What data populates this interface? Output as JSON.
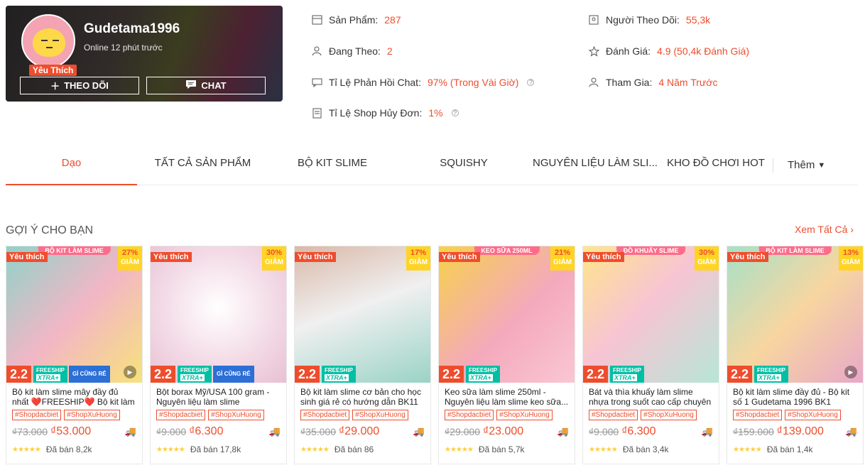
{
  "shop": {
    "name": "Gudetama1996",
    "status": "Online 12 phút trước",
    "badge": "Yêu Thích",
    "follow_label": "THEO DÕI",
    "chat_label": "CHAT"
  },
  "stats": {
    "products_label": "Sản Phẩm:",
    "products_value": "287",
    "following_label": "Đang Theo:",
    "following_value": "2",
    "chat_label": "Tỉ Lệ Phản Hồi Chat:",
    "chat_value": "97% (Trong Vài Giờ)",
    "cancel_label": "Tỉ Lệ Shop Hủy Đơn:",
    "cancel_value": "1%",
    "followers_label": "Người Theo Dõi:",
    "followers_value": "55,3k",
    "rating_label": "Đánh Giá:",
    "rating_value": "4.9 (50,4k Đánh Giá)",
    "joined_label": "Tham Gia:",
    "joined_value": "4 Năm Trước"
  },
  "tabs": [
    "Dạo",
    "TẤT CẢ SẢN PHẨM",
    "BỘ KIT SLIME",
    "SQUISHY",
    "NGUYÊN LIỆU LÀM SLI...",
    "KHO ĐỒ CHƠI HOT"
  ],
  "tab_more": "Thêm",
  "section": {
    "title": "GỢI Ý CHO BẠN",
    "see_all": "Xem Tất Cả"
  },
  "promo": {
    "day": "2.2",
    "freeship_top": "FREESHIP",
    "freeship_bottom": "XTRA+",
    "cheap": "GÌ CŨNG RẺ",
    "discount_word": "GIẢM",
    "fav": "Yêu thích"
  },
  "products": [
    {
      "name": "Bộ kit làm slime mây đầy đủ nhất ❤️FREESHIP❤️ Bộ kit làm clou...",
      "banner": "BỘ KIT LÀM SLIME",
      "discount": "27%",
      "old": "₫73.000",
      "new": "₫53.000",
      "sold": "Đã bán 8,2k",
      "tags": [
        "#Shopdacbiet",
        "#ShopXuHuong"
      ],
      "fav": true,
      "cheap": true,
      "video": true
    },
    {
      "name": "Bột borax Mỹ/USA 100 gram - Nguyên liệu làm slime",
      "banner": "",
      "discount": "30%",
      "old": "₫9.000",
      "new": "₫6.300",
      "sold": "Đã bán 17,8k",
      "tags": [
        "#Shopdacbiet",
        "#ShopXuHuong"
      ],
      "fav": true,
      "cheap": true,
      "video": false
    },
    {
      "name": "Bộ kit làm slime cơ bản cho học sinh giá rẻ có hướng dẫn BK11",
      "banner": "",
      "discount": "17%",
      "old": "₫35.000",
      "new": "₫29.000",
      "sold": "Đã bán 86",
      "tags": [
        "#Shopdacbiet",
        "#ShopXuHuong"
      ],
      "fav": true,
      "cheap": false,
      "video": false
    },
    {
      "name": "Keo sữa làm slime 250ml - Nguyên liệu làm slime keo sữa...",
      "banner": "KEO SỮA 250ML",
      "discount": "21%",
      "old": "₫29.000",
      "new": "₫23.000",
      "sold": "Đã bán 5,7k",
      "tags": [
        "#Shopdacbiet",
        "#ShopXuHuong"
      ],
      "fav": true,
      "cheap": false,
      "video": false
    },
    {
      "name": "Bát và thìa khuấy làm slime nhựa trong suốt cao cấp chuyên dụn...",
      "banner": "ĐỒ KHUẤY SLIME",
      "discount": "30%",
      "old": "₫9.000",
      "new": "₫6.300",
      "sold": "Đã bán 3,4k",
      "tags": [
        "#Shopdacbiet",
        "#ShopXuHuong"
      ],
      "fav": true,
      "cheap": false,
      "video": false
    },
    {
      "name": "Bộ kit làm slime đầy đủ - Bộ kit số 1 Gudetama 1996 BK1",
      "banner": "BỘ KIT LÀM SLIME",
      "discount": "13%",
      "old": "₫159.000",
      "new": "₫139.000",
      "sold": "Đã bán 1,4k",
      "tags": [
        "#Shopdacbiet",
        "#ShopXuHuong"
      ],
      "fav": true,
      "cheap": false,
      "video": true
    }
  ],
  "colors": {
    "accent": "#ee4d2d",
    "freeship": "#00bfa5",
    "discount_bg": "#ffd424"
  }
}
